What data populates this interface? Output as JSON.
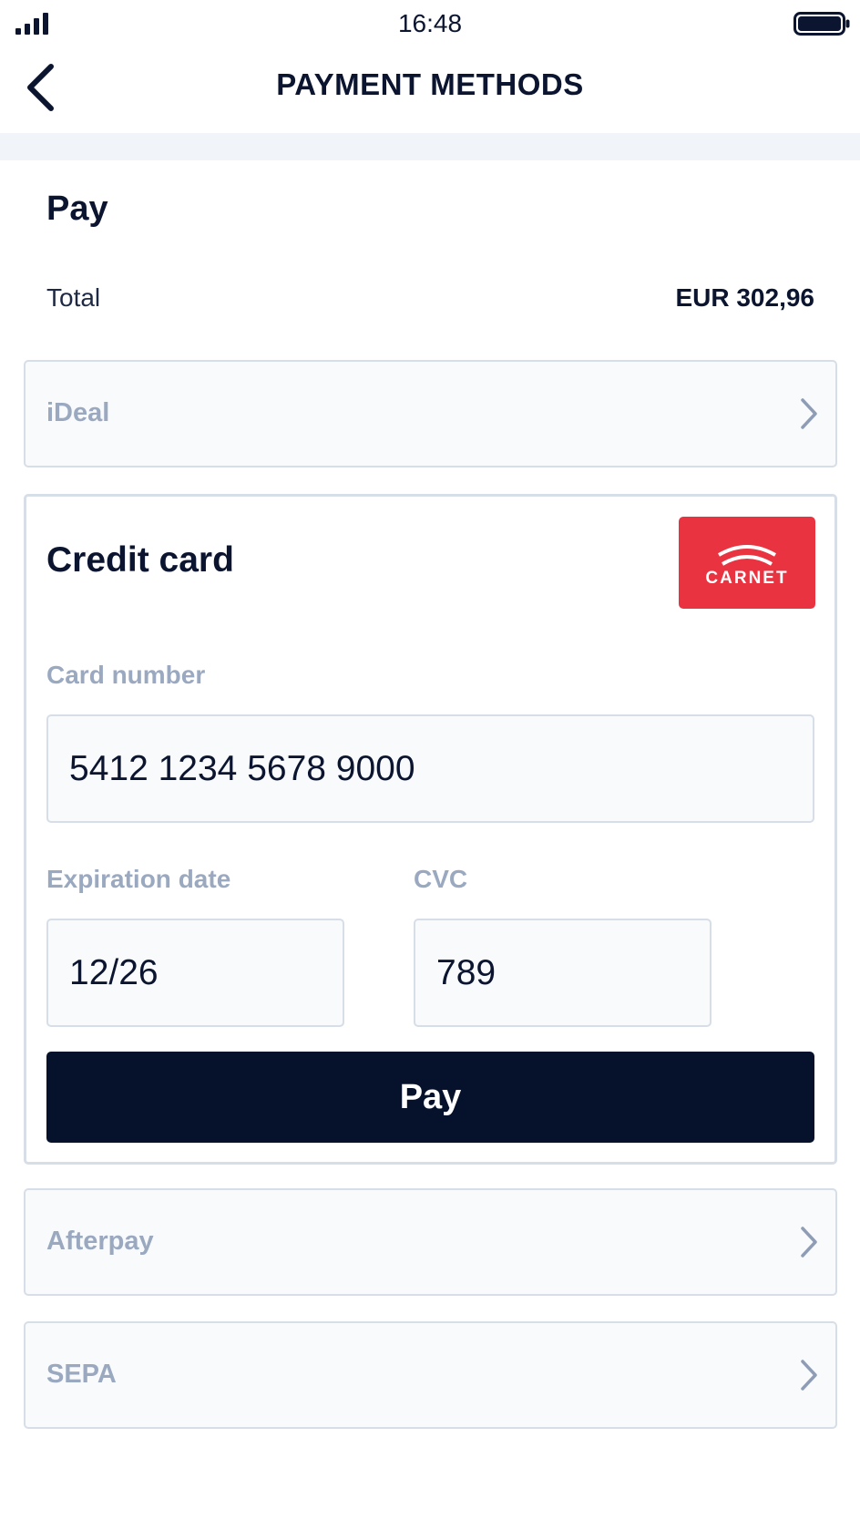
{
  "status_bar": {
    "time": "16:48",
    "signal_icon": "cellular-signal-icon",
    "battery_icon": "battery-full-icon"
  },
  "nav": {
    "title": "PAYMENT METHODS",
    "back_icon": "chevron-left-icon"
  },
  "summary": {
    "heading": "Pay",
    "total_label": "Total",
    "total_value": "EUR 302,96"
  },
  "methods": {
    "ideal": {
      "label": "iDeal"
    },
    "afterpay": {
      "label": "Afterpay"
    },
    "sepa": {
      "label": "SEPA"
    }
  },
  "credit_card": {
    "title": "Credit card",
    "brand_logo": {
      "text": "CARNET",
      "color": "#ea3340"
    },
    "card_number": {
      "label": "Card number",
      "value": "5412 1234 5678 9000"
    },
    "expiration": {
      "label": "Expiration date",
      "value": "12/26"
    },
    "cvc": {
      "label": "CVC",
      "value": "789"
    },
    "pay_label": "Pay"
  },
  "colors": {
    "primary_dark": "#06122c",
    "muted_label": "#9aa9c0",
    "border": "#d7dee8",
    "field_bg": "#f8fafc"
  }
}
